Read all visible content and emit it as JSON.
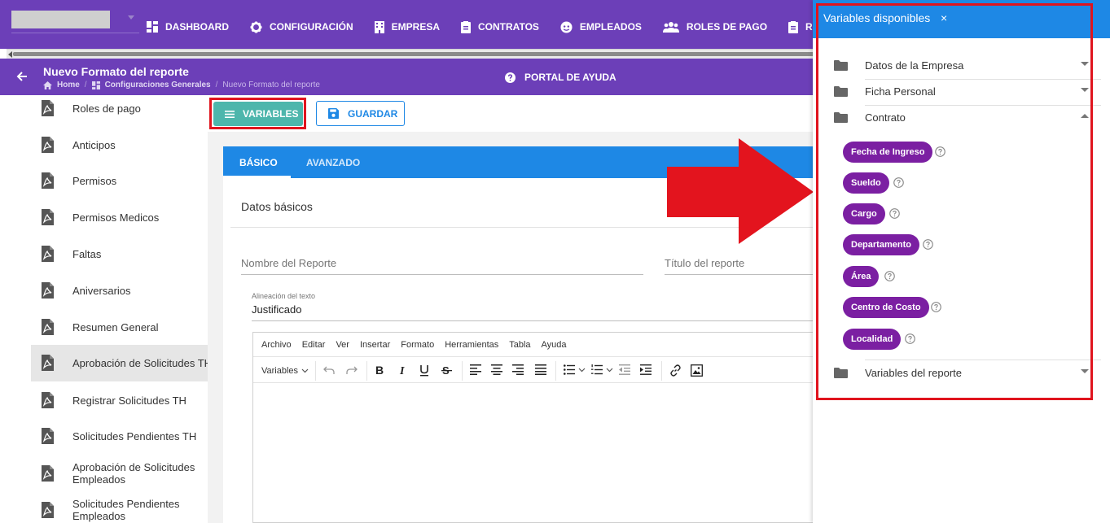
{
  "nav": {
    "items": [
      {
        "label": "DASHBOARD",
        "icon": "dashboard-icon"
      },
      {
        "label": "CONFIGURACIÓN",
        "icon": "gear-icon"
      },
      {
        "label": "EMPRESA",
        "icon": "building-icon"
      },
      {
        "label": "CONTRATOS",
        "icon": "contract-icon"
      },
      {
        "label": "EMPLEADOS",
        "icon": "employee-icon"
      },
      {
        "label": "ROLES DE PAGO",
        "icon": "group-icon"
      },
      {
        "label": "REPOR",
        "icon": "report-icon"
      }
    ]
  },
  "header": {
    "title": "Nuevo Formato del reporte",
    "breadcrumb": {
      "home": "Home",
      "config": "Configuraciones Generales",
      "current": "Nuevo Formato del reporte"
    },
    "help_portal": "PORTAL DE AYUDA"
  },
  "sidebar": {
    "items": [
      {
        "label": "Roles de pago"
      },
      {
        "label": "Anticipos"
      },
      {
        "label": "Permisos"
      },
      {
        "label": "Permisos Medicos"
      },
      {
        "label": "Faltas"
      },
      {
        "label": "Aniversarios"
      },
      {
        "label": "Resumen General"
      },
      {
        "label": "Aprobación de Solicitudes TH",
        "active": true
      },
      {
        "label": "Registrar Solicitudes TH"
      },
      {
        "label": "Solicitudes Pendientes TH"
      },
      {
        "label": "Aprobación de Solicitudes Empleados"
      },
      {
        "label": "Solicitudes Pendientes Empleados"
      }
    ]
  },
  "toolbar": {
    "variables_label": "VARIABLES",
    "save_label": "GUARDAR"
  },
  "form": {
    "tabs": {
      "basic": "BÁSICO",
      "advanced": "AVANZADO"
    },
    "section_title": "Datos básicos",
    "report_name_placeholder": "Nombre del Reporte",
    "report_title_placeholder": "Título del reporte",
    "alignment_label": "Alineación del texto",
    "alignment_value": "Justificado"
  },
  "editor": {
    "menu": [
      "Archivo",
      "Editar",
      "Ver",
      "Insertar",
      "Formato",
      "Herramientas",
      "Tabla",
      "Ayuda"
    ],
    "variables_dropdown": "Variables"
  },
  "panel": {
    "title": "Variables disponibles",
    "close": "×",
    "groups": {
      "empresa": "Datos de la Empresa",
      "ficha": "Ficha Personal",
      "contrato": "Contrato",
      "reporte": "Variables del reporte"
    },
    "contract_variables": [
      "Fecha de Ingreso",
      "Sueldo",
      "Cargo",
      "Departamento",
      "Área",
      "Centro de Costo",
      "Localidad"
    ]
  },
  "colors": {
    "primary_purple": "#6c3fb8",
    "primary_blue": "#1e88e5",
    "teal_button": "#4db6ac",
    "chip_purple": "#7b1fa2",
    "annotation_red": "#e0141e"
  }
}
